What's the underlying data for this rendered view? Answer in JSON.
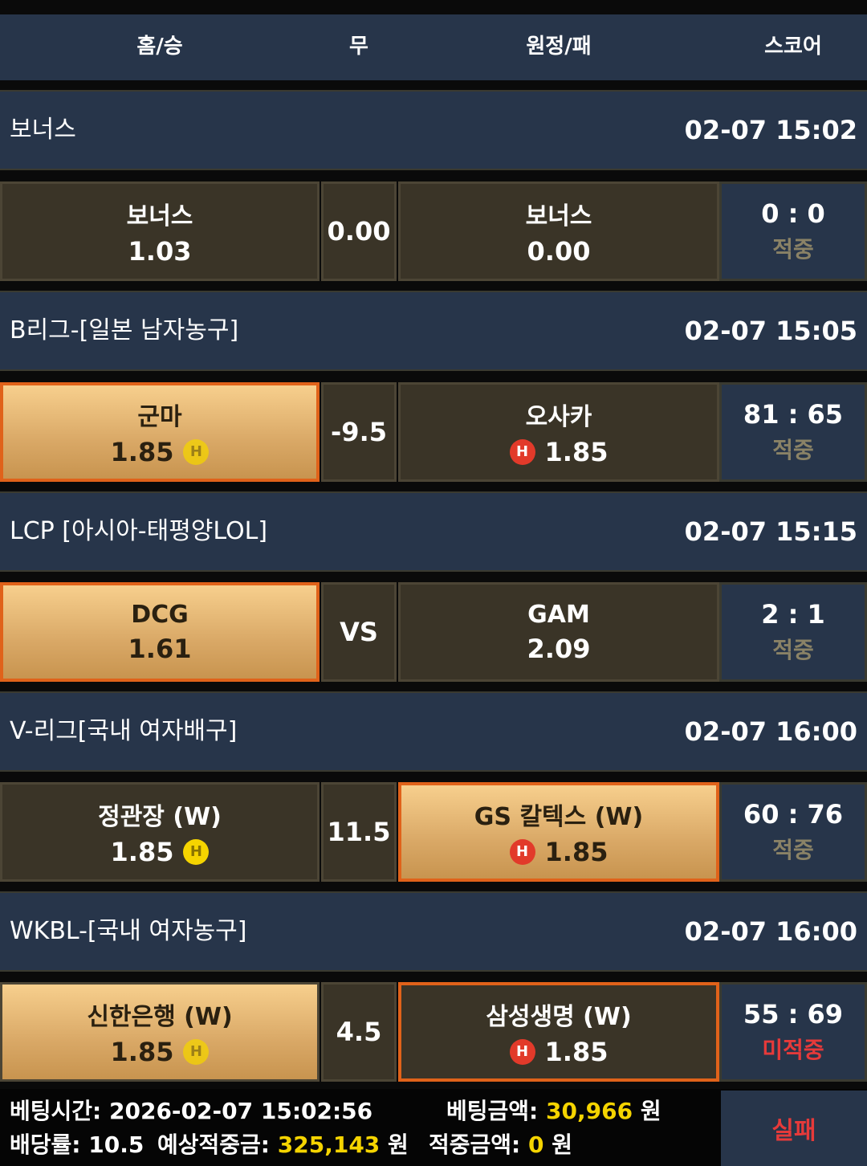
{
  "header": {
    "home": "홈/승",
    "draw": "무",
    "away": "원정/패",
    "score": "스코어"
  },
  "matches": [
    {
      "league": "보너스",
      "time": "02-07 15:02",
      "home": {
        "team": "보너스",
        "odds": "1.03"
      },
      "mid": "0.00",
      "away": {
        "team": "보너스",
        "odds": "0.00"
      },
      "score": "0 : 0",
      "result": "적중"
    },
    {
      "league": "B리그-[일본 남자농구]",
      "time": "02-07 15:05",
      "home": {
        "team": "군마",
        "odds": "1.85",
        "badge": "H"
      },
      "mid": "-9.5",
      "away": {
        "team": "오사카",
        "odds": "1.85",
        "badge": "H"
      },
      "score": "81 : 65",
      "result": "적중"
    },
    {
      "league": "LCP [아시아-태평양LOL]",
      "time": "02-07 15:15",
      "home": {
        "team": "DCG",
        "odds": "1.61"
      },
      "mid": "VS",
      "away": {
        "team": "GAM",
        "odds": "2.09"
      },
      "score": "2 : 1",
      "result": "적중"
    },
    {
      "league": "V-리그[국내 여자배구]",
      "time": "02-07 16:00",
      "home": {
        "team": "정관장 (W)",
        "odds": "1.85",
        "badge": "H"
      },
      "mid": "11.5",
      "away": {
        "team": "GS 칼텍스 (W)",
        "odds": "1.85",
        "badge": "H"
      },
      "score": "60 : 76",
      "result": "적중"
    },
    {
      "league": "WKBL-[국내 여자농구]",
      "time": "02-07 16:00",
      "home": {
        "team": "신한은행 (W)",
        "odds": "1.85",
        "badge": "H"
      },
      "mid": "4.5",
      "away": {
        "team": "삼성생명 (W)",
        "odds": "1.85",
        "badge": "H"
      },
      "score": "55 : 69",
      "result": "미적중"
    }
  ],
  "footer": {
    "bet_time_label": "베팅시간:",
    "bet_time": "2026-02-07 15:02:56",
    "bet_amount_label": "베팅금액:",
    "bet_amount": "30,966",
    "won": "원",
    "odds_label": "배당률:",
    "odds": "10.5",
    "expected_label": "예상적중금:",
    "expected": "325,143",
    "win_label": "적중금액:",
    "win": "0",
    "result": "실패"
  },
  "colors": {
    "panel": "#27354a",
    "cell": "#3a3427",
    "selected_border": "#e0621a",
    "gold": "#d9a866",
    "hit": "#8a8266",
    "miss": "#e63a3a",
    "highlight": "#f5d400"
  }
}
